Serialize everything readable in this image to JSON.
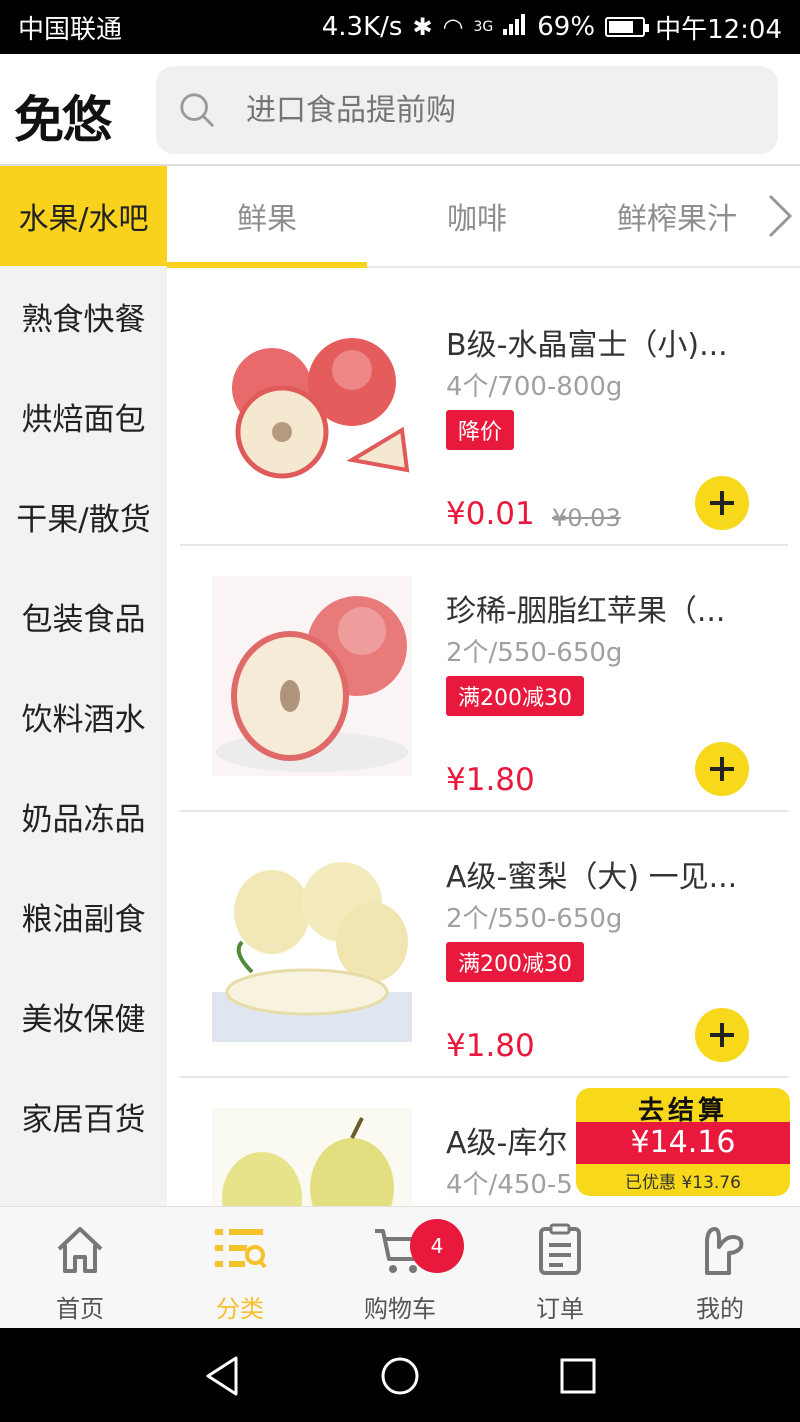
{
  "status_bar": {
    "carrier": "中国联通",
    "speed": "4.3K/s",
    "network": "3G",
    "battery": "69%",
    "time": "中午12:04"
  },
  "header": {
    "logo": "免悠",
    "search_placeholder": "进口食品提前购"
  },
  "sidebar": {
    "items": [
      {
        "label": "水果/水吧",
        "active": true
      },
      {
        "label": "熟食快餐"
      },
      {
        "label": "烘焙面包"
      },
      {
        "label": "干果/散货"
      },
      {
        "label": "包装食品"
      },
      {
        "label": "饮料酒水"
      },
      {
        "label": "奶品冻品"
      },
      {
        "label": "粮油副食"
      },
      {
        "label": "美妆保健"
      },
      {
        "label": "家居百货"
      }
    ]
  },
  "subtabs": {
    "items": [
      {
        "label": "鲜果",
        "active": true
      },
      {
        "label": "咖啡"
      },
      {
        "label": "鲜榨果汁"
      }
    ]
  },
  "products": [
    {
      "name": "B级-水晶富士（小)...",
      "spec": "4个/700-800g",
      "tag": "降价",
      "price": "¥0.01",
      "original_price": "¥0.03"
    },
    {
      "name": "珍稀-胭脂红苹果（...",
      "spec": "2个/550-650g",
      "tag": "满200减30",
      "price": "¥1.80"
    },
    {
      "name": "A级-蜜梨（大) 一见...",
      "spec": "2个/550-650g",
      "tag": "满200减30",
      "price": "¥1.80"
    },
    {
      "name": "A级-库尔",
      "spec": "4个/450-5",
      "tag": "",
      "price": ""
    }
  ],
  "checkout": {
    "label": "去结算",
    "total": "¥14.16",
    "saved": "已优惠 ¥13.76"
  },
  "bottom_nav": {
    "items": [
      {
        "label": "首页",
        "icon": "home-icon"
      },
      {
        "label": "分类",
        "icon": "category-icon",
        "active": true
      },
      {
        "label": "购物车",
        "icon": "cart-icon",
        "badge": "4"
      },
      {
        "label": "订单",
        "icon": "order-icon"
      },
      {
        "label": "我的",
        "icon": "profile-icon"
      }
    ]
  },
  "colors": {
    "accent_yellow": "#f8d21c",
    "price_red": "#e8193c"
  }
}
